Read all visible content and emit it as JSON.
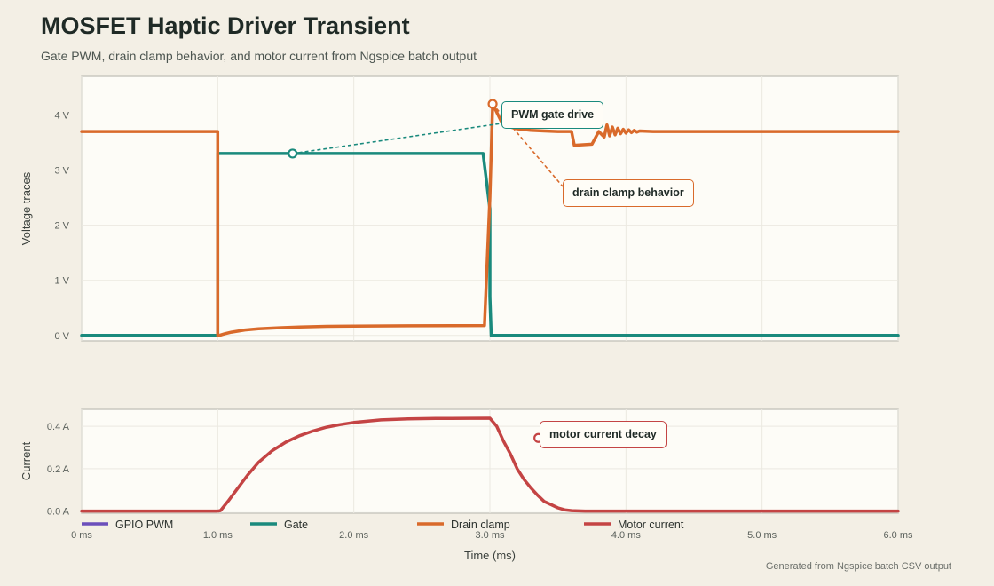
{
  "header": {
    "title": "MOSFET Haptic Driver Transient",
    "subtitle": "Gate PWM, drain clamp behavior, and motor current from Ngspice batch output"
  },
  "footer": {
    "note": "Generated from Ngspice batch CSV output"
  },
  "colors": {
    "background": "#f3efe5",
    "plot_background": "#fdfcf7",
    "gpio_pwm": "#6b4fbb",
    "gate": "#1a8a7d",
    "drain_clamp": "#d96a2b",
    "motor_current": "#c44444"
  },
  "chart_data": [
    {
      "type": "line",
      "panel": "voltage",
      "ylabel": "Voltage traces",
      "xlim": [
        0,
        6
      ],
      "ylim": [
        -0.1,
        4.7
      ],
      "yticks": [
        0,
        1,
        2,
        3,
        4
      ],
      "ytick_labels": [
        "0 V",
        "1 V",
        "2 V",
        "3 V",
        "4 V"
      ],
      "grid": true,
      "series": [
        {
          "name": "Gate",
          "color": "#1a8a7d",
          "x": [
            0,
            1.0,
            1.0,
            1.03,
            2.95,
            3.0,
            3.0,
            3.01,
            6.0
          ],
          "y": [
            0,
            0,
            3.3,
            3.3,
            3.3,
            2.3,
            0.7,
            0,
            0
          ]
        },
        {
          "name": "Drain clamp",
          "color": "#d96a2b",
          "x": [
            0,
            1.0,
            1.0,
            1.01,
            1.05,
            1.1,
            1.2,
            1.3,
            1.45,
            1.6,
            1.8,
            2.0,
            2.4,
            2.96,
            3.0,
            3.02,
            3.05,
            3.08,
            3.1,
            3.15,
            3.2,
            3.3,
            3.4,
            3.5,
            3.56,
            3.6,
            3.62,
            3.75,
            3.8,
            3.84,
            3.86,
            3.88,
            3.9,
            3.92,
            3.94,
            3.96,
            3.98,
            4.0,
            4.02,
            4.04,
            4.06,
            4.08,
            4.1,
            4.14,
            4.2,
            4.3,
            6.0
          ],
          "y": [
            3.7,
            3.7,
            0.0,
            0.0,
            0.03,
            0.06,
            0.1,
            0.12,
            0.14,
            0.155,
            0.165,
            0.17,
            0.175,
            0.18,
            2.5,
            4.2,
            4.05,
            3.9,
            3.82,
            3.78,
            3.75,
            3.72,
            3.71,
            3.7,
            3.7,
            3.7,
            3.45,
            3.47,
            3.7,
            3.6,
            3.82,
            3.62,
            3.78,
            3.64,
            3.76,
            3.66,
            3.74,
            3.67,
            3.73,
            3.68,
            3.72,
            3.69,
            3.71,
            3.705,
            3.7,
            3.7,
            3.7
          ]
        }
      ],
      "annotations": [
        {
          "text": "PWM gate drive",
          "x": 1.55,
          "y": 3.3,
          "color": "#1a8a7d",
          "side": "gate"
        },
        {
          "text": "drain clamp behavior",
          "x": 3.02,
          "y": 4.2,
          "color": "#d96a2b",
          "side": "drain"
        }
      ]
    },
    {
      "type": "line",
      "panel": "current",
      "ylabel": "Current",
      "xlabel": "Time (ms)",
      "xlim": [
        0,
        6
      ],
      "ylim": [
        -0.01,
        0.48
      ],
      "yticks": [
        0,
        0.2,
        0.4
      ],
      "ytick_labels": [
        "0.0 A",
        "0.2 A",
        "0.4 A"
      ],
      "xticks": [
        0,
        1,
        2,
        3,
        4,
        5,
        6
      ],
      "xtick_labels": [
        "0 ms",
        "1.0 ms",
        "2.0 ms",
        "3.0 ms",
        "4.0 ms",
        "5.0 ms",
        "6.0 ms"
      ],
      "grid": true,
      "series": [
        {
          "name": "Motor current",
          "color": "#c44444",
          "x": [
            0,
            1.0,
            1.02,
            1.08,
            1.15,
            1.22,
            1.3,
            1.4,
            1.5,
            1.6,
            1.7,
            1.8,
            1.9,
            2.0,
            2.2,
            2.4,
            2.6,
            3.0,
            3.05,
            3.1,
            3.15,
            3.2,
            3.25,
            3.3,
            3.35,
            3.4,
            3.45,
            3.5,
            3.55,
            3.6,
            3.65,
            3.7,
            4.0,
            6.0
          ],
          "y": [
            0,
            0,
            0.002,
            0.05,
            0.11,
            0.17,
            0.23,
            0.285,
            0.325,
            0.355,
            0.378,
            0.396,
            0.408,
            0.418,
            0.43,
            0.435,
            0.437,
            0.438,
            0.4,
            0.33,
            0.27,
            0.2,
            0.15,
            0.11,
            0.075,
            0.045,
            0.03,
            0.015,
            0.006,
            0.002,
            0.001,
            0.0,
            0.0,
            0.0
          ]
        }
      ],
      "annotations": [
        {
          "text": "motor current decay",
          "x": 3.35,
          "y": 0.345,
          "color": "#c44444",
          "side": "current"
        }
      ]
    }
  ],
  "legend": [
    {
      "name": "GPIO PWM",
      "color": "#6b4fbb"
    },
    {
      "name": "Gate",
      "color": "#1a8a7d"
    },
    {
      "name": "Drain clamp",
      "color": "#d96a2b"
    },
    {
      "name": "Motor current",
      "color": "#c44444"
    }
  ]
}
